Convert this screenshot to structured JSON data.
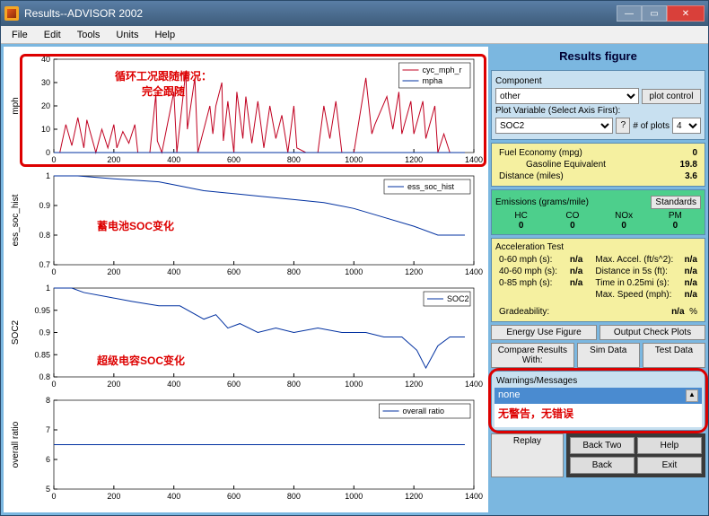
{
  "window": {
    "title": "Results--ADVISOR 2002"
  },
  "menu": {
    "file": "File",
    "edit": "Edit",
    "tools": "Tools",
    "units": "Units",
    "help": "Help"
  },
  "side": {
    "title": "Results figure",
    "component_label": "Component",
    "component_value": "other",
    "plot_control": "plot control",
    "plotvar_label": "Plot Variable (Select Axis First):",
    "plotvar_value": "SOC2",
    "numplots_label": "# of plots",
    "numplots_value": "4",
    "fuel": {
      "fe_label": "Fuel Economy (mpg)",
      "fe_val": "0",
      "ge_label": "Gasoline Equivalent",
      "ge_val": "19.8",
      "dist_label": "Distance (miles)",
      "dist_val": "3.6"
    },
    "emiss": {
      "label": "Emissions (grams/mile)",
      "standards": "Standards",
      "hc": "HC",
      "co": "CO",
      "nox": "NOx",
      "pm": "PM",
      "hc_v": "0",
      "co_v": "0",
      "nox_v": "0",
      "pm_v": "0"
    },
    "accel": {
      "title": "Acceleration Test",
      "l1": "0-60 mph (s):",
      "v1": "n/a",
      "l2": "40-60 mph (s):",
      "v2": "n/a",
      "l3": "0-85 mph (s):",
      "v3": "n/a",
      "r1": "Max. Accel. (ft/s^2):",
      "rv1": "n/a",
      "r2": "Distance in 5s (ft):",
      "rv2": "n/a",
      "r3": "Time in 0.25mi (s):",
      "rv3": "n/a",
      "r4": "Max. Speed (mph):",
      "rv4": "n/a",
      "grade_label": "Gradeability:",
      "grade_val": "n/a",
      "grade_pct": "%"
    },
    "energy_btn": "Energy Use Figure",
    "output_btn": "Output Check Plots",
    "compare_label": "Compare Results With:",
    "simdata": "Sim Data",
    "testdata": "Test Data",
    "warn_hdr": "Warnings/Messages",
    "warn_item": "none",
    "replay": "Replay",
    "backtwo": "Back Two",
    "helpbtn": "Help",
    "back": "Back",
    "exit": "Exit"
  },
  "annotations": {
    "a1_line1": "循环工况跟随情况：",
    "a1_line2": "完全跟随",
    "a2": "蓄电池SOC变化",
    "a3": "超级电容SOC变化",
    "a4": "无警告，无错误"
  },
  "chart_data": [
    {
      "type": "line",
      "ylabel": "mph",
      "xlim": [
        0,
        1400
      ],
      "ylim": [
        0,
        40
      ],
      "xticks": [
        0,
        200,
        400,
        600,
        800,
        1000,
        1200,
        1400
      ],
      "yticks": [
        0,
        10,
        20,
        30,
        40
      ],
      "legend": [
        "cyc_mph_r",
        "mpha"
      ],
      "series": [
        {
          "name": "cyc_mph_r",
          "color": "#c00020",
          "x": [
            0,
            20,
            40,
            60,
            80,
            100,
            110,
            140,
            160,
            180,
            200,
            210,
            230,
            250,
            270,
            280,
            320,
            340,
            345,
            360,
            400,
            410,
            440,
            445,
            470,
            480,
            520,
            530,
            540,
            560,
            565,
            580,
            600,
            610,
            630,
            640,
            660,
            680,
            700,
            720,
            740,
            760,
            780,
            800,
            810,
            840,
            880,
            900,
            920,
            940,
            960,
            1000,
            1040,
            1060,
            1070,
            1110,
            1130,
            1150,
            1160,
            1190,
            1200,
            1230,
            1240,
            1270,
            1280,
            1300,
            1320,
            1370
          ],
          "y": [
            0,
            0,
            12,
            3,
            15,
            2,
            14,
            0,
            10,
            2,
            12,
            2,
            9,
            4,
            12,
            0,
            0,
            25,
            5,
            0,
            26,
            0,
            35,
            10,
            32,
            0,
            20,
            8,
            20,
            30,
            5,
            22,
            0,
            26,
            6,
            24,
            4,
            22,
            2,
            20,
            6,
            16,
            0,
            20,
            2,
            0,
            0,
            20,
            6,
            22,
            0,
            0,
            32,
            8,
            12,
            24,
            10,
            26,
            8,
            22,
            8,
            22,
            6,
            20,
            0,
            8,
            0,
            0
          ]
        },
        {
          "name": "mpha",
          "color": "#0030a0",
          "x": [
            0,
            1370
          ],
          "y": [
            0,
            0
          ]
        }
      ]
    },
    {
      "type": "line",
      "ylabel": "ess_soc_hist",
      "xlim": [
        0,
        1400
      ],
      "ylim": [
        0.7,
        1.0
      ],
      "xticks": [
        0,
        200,
        400,
        600,
        800,
        1000,
        1200,
        1400
      ],
      "yticks": [
        0.7,
        0.8,
        0.9,
        1
      ],
      "legend": [
        "ess_soc_hist"
      ],
      "series": [
        {
          "name": "ess_soc_hist",
          "color": "#0030a0",
          "x": [
            0,
            80,
            200,
            350,
            400,
            500,
            600,
            700,
            800,
            900,
            1000,
            1100,
            1200,
            1280,
            1320,
            1370
          ],
          "y": [
            1.0,
            1.0,
            0.99,
            0.98,
            0.97,
            0.95,
            0.94,
            0.93,
            0.92,
            0.91,
            0.89,
            0.86,
            0.83,
            0.8,
            0.8,
            0.8
          ]
        }
      ]
    },
    {
      "type": "line",
      "ylabel": "SOC2",
      "xlim": [
        0,
        1400
      ],
      "ylim": [
        0.8,
        1.0
      ],
      "xticks": [
        0,
        200,
        400,
        600,
        800,
        1000,
        1200,
        1400
      ],
      "yticks": [
        0.8,
        0.85,
        0.9,
        0.95,
        1
      ],
      "legend": [
        "SOC2"
      ],
      "series": [
        {
          "name": "SOC2",
          "color": "#0030a0",
          "x": [
            0,
            60,
            100,
            180,
            260,
            350,
            420,
            500,
            540,
            580,
            620,
            680,
            740,
            800,
            880,
            960,
            1040,
            1100,
            1160,
            1210,
            1240,
            1280,
            1320,
            1370
          ],
          "y": [
            1.0,
            1.0,
            0.99,
            0.98,
            0.97,
            0.96,
            0.96,
            0.93,
            0.94,
            0.91,
            0.92,
            0.9,
            0.91,
            0.9,
            0.91,
            0.9,
            0.9,
            0.89,
            0.89,
            0.86,
            0.82,
            0.87,
            0.89,
            0.89
          ]
        }
      ]
    },
    {
      "type": "line",
      "ylabel": "overall ratio",
      "xlim": [
        0,
        1400
      ],
      "ylim": [
        5,
        8
      ],
      "xticks": [
        0,
        200,
        400,
        600,
        800,
        1000,
        1200,
        1400
      ],
      "yticks": [
        5,
        6,
        7,
        8
      ],
      "legend": [
        "overall ratio"
      ],
      "series": [
        {
          "name": "overall ratio",
          "color": "#0030a0",
          "x": [
            0,
            1370
          ],
          "y": [
            6.5,
            6.5
          ]
        }
      ]
    }
  ]
}
